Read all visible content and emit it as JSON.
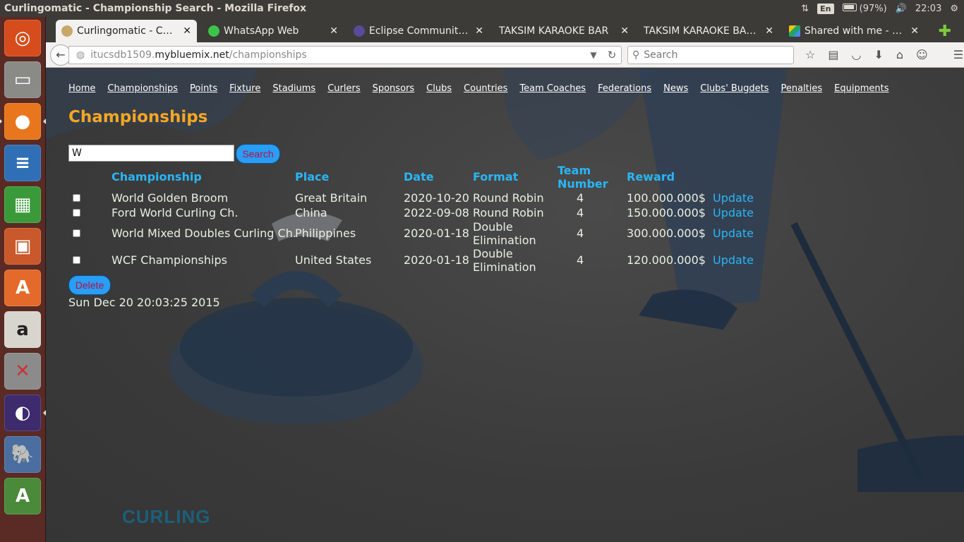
{
  "os": {
    "window_title": "Curlingomatic - Championship Search - Mozilla Firefox",
    "language": "En",
    "battery": "(97%)",
    "time": "22:03"
  },
  "tabs": [
    {
      "label": "Curlingomatic - Cha…"
    },
    {
      "label": "WhatsApp Web"
    },
    {
      "label": "Eclipse Community …"
    },
    {
      "label": "TAKSIM KARAOKE BAR"
    },
    {
      "label": "TAKSIM KARAOKE BAR…"
    },
    {
      "label": "Shared with me - Go…"
    }
  ],
  "navbar": {
    "url_prefix": "itucsdb1509.",
    "url_host": "mybluemix.net",
    "url_path": "/championships",
    "search_placeholder": "Search"
  },
  "page": {
    "nav_links": [
      "Home",
      "Championships",
      "Points",
      "Fixture",
      "Stadiums",
      "Curlers",
      "Sponsors",
      "Clubs",
      "Countries",
      "Team Coaches",
      "Federations",
      "News",
      "Clubs' Bugdets",
      "Penalties",
      "Equipments"
    ],
    "title": "Championships",
    "search_value": "W",
    "search_button": "Search",
    "delete_button": "Delete",
    "timestamp": "Sun Dec 20 20:03:25 2015",
    "columns": {
      "championship": "Championship",
      "place": "Place",
      "date": "Date",
      "format": "Format",
      "team_number_1": "Team",
      "team_number_2": "Number",
      "reward": "Reward"
    },
    "rows": [
      {
        "championship": "World Golden Broom",
        "place": "Great Britain",
        "date": "2020-10-20",
        "format_1": "Round Robin",
        "format_2": "",
        "team_number": "4",
        "reward": "100.000.000$",
        "action": "Update"
      },
      {
        "championship": "Ford World Curling Ch.",
        "place": "China",
        "date": "2022-09-08",
        "format_1": "Round Robin",
        "format_2": "",
        "team_number": "4",
        "reward": "150.000.000$",
        "action": "Update"
      },
      {
        "championship": "World Mixed Doubles Curling Ch.",
        "place": "Philippines",
        "date": "2020-01-18",
        "format_1": "Double",
        "format_2": "Elimination",
        "team_number": "4",
        "reward": "300.000.000$",
        "action": "Update"
      },
      {
        "championship": "WCF Championships",
        "place": "United States",
        "date": "2020-01-18",
        "format_1": "Double",
        "format_2": "Elimination",
        "team_number": "4",
        "reward": "120.000.000$",
        "action": "Update"
      }
    ],
    "logo_text": "CURLING"
  }
}
